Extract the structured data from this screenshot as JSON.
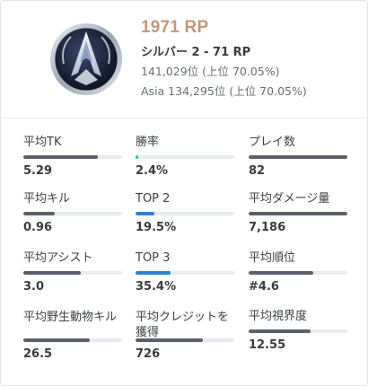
{
  "header": {
    "emblem": "silver-tier-emblem-icon",
    "rp": "1971 RP",
    "tier": "シルバー 2 - 71 RP",
    "rank_global": "141,029位 (上位 70.05%)",
    "rank_region": "Asia 134,295位 (上位 70.05%)"
  },
  "colors": {
    "rp": "#c2977c",
    "bar_track": "#e9eaed",
    "bar_dark": "#5c5f6b",
    "bar_green": "#1ec8a5",
    "bar_blue": "#2e7fcf"
  },
  "stats": [
    {
      "label": "平均TK",
      "value": "5.29",
      "fill": 0.75,
      "color": "#5c5f6b"
    },
    {
      "label": "勝率",
      "value": "2.4%",
      "fill": 0.03,
      "color": "#1ec8a5"
    },
    {
      "label": "プレイ数",
      "value": "82",
      "fill": 1.0,
      "color": "#5c5f6b"
    },
    {
      "label": "平均キル",
      "value": "0.96",
      "fill": 0.32,
      "color": "#5c5f6b"
    },
    {
      "label": "TOP 2",
      "value": "19.5%",
      "fill": 0.19,
      "color": "#2e7fcf"
    },
    {
      "label": "平均ダメージ量",
      "value": "7,186",
      "fill": 1.0,
      "color": "#5c5f6b"
    },
    {
      "label": "平均アシスト",
      "value": "3.0",
      "fill": 0.58,
      "color": "#5c5f6b"
    },
    {
      "label": "TOP 3",
      "value": "35.4%",
      "fill": 0.35,
      "color": "#2e7fcf"
    },
    {
      "label": "平均順位",
      "value": "#4.6",
      "fill": 0.65,
      "color": "#5c5f6b"
    },
    {
      "label": "平均野生動物キル",
      "value": "26.5",
      "fill": 0.67,
      "color": "#5c5f6b"
    },
    {
      "label": "平均クレジットを獲得",
      "value": "726",
      "fill": 0.68,
      "color": "#5c5f6b"
    },
    {
      "label": "平均視界度",
      "value": "12.55",
      "fill": 0.63,
      "color": "#5c5f6b"
    }
  ]
}
